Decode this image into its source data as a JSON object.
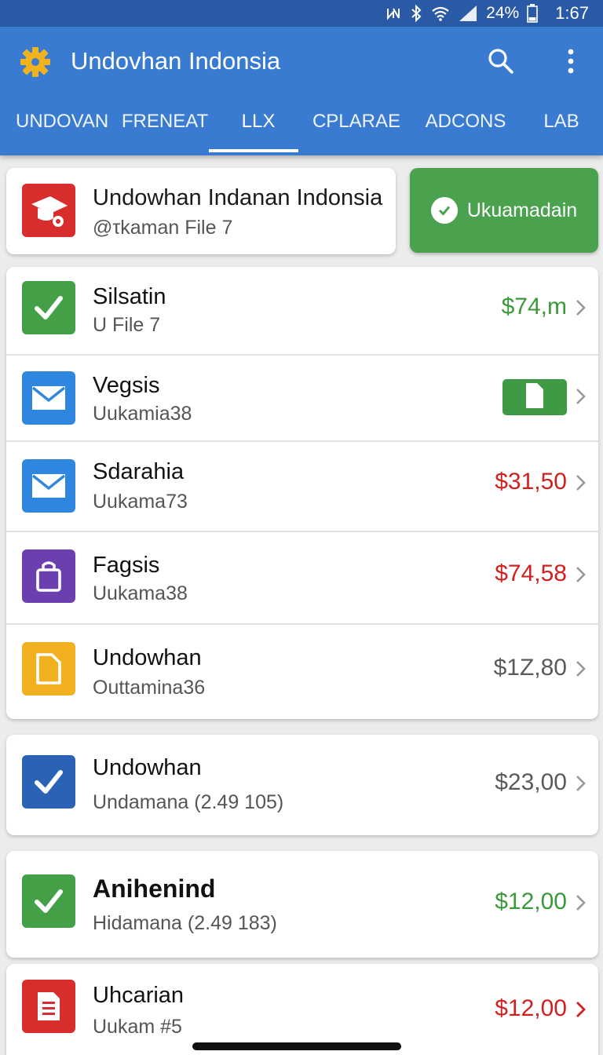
{
  "status_bar": {
    "battery": "24%",
    "time": "1:67",
    "icons": [
      "nfc-icon",
      "bluetooth-icon",
      "wifi-icon",
      "signal-icon",
      "battery-icon"
    ]
  },
  "app_bar": {
    "title": "Undovhan Indonsia",
    "logo_icon": "gear-icon",
    "color": "#3a7bd2"
  },
  "tabs": [
    {
      "label": "UNDOVAN"
    },
    {
      "label": "FRENEAT"
    },
    {
      "label": "LLX",
      "active": true
    },
    {
      "label": "CPLARAE"
    },
    {
      "label": "ADCONS"
    },
    {
      "label": "LAB"
    }
  ],
  "header_card": {
    "title": "Undowhan Indanan Indonsia",
    "subtitle": "@τkaman File 7",
    "icon": "graduation-cap-gear-icon"
  },
  "action_button": {
    "label": "Ukuamadain",
    "icon": "check-circle-icon",
    "color": "#4aa24f"
  },
  "list_group_1": [
    {
      "title": "Silsatin",
      "subtitle": "U File 7",
      "amount": "$74,m",
      "amount_color": "green",
      "icon": "checkmark-icon",
      "icon_color": "#43a047"
    },
    {
      "title": "Vegsis",
      "subtitle": "Uukamia38",
      "amount": "",
      "badge": "file-icon",
      "icon": "mail-icon",
      "icon_color": "#2e86de"
    },
    {
      "title": "Sdarahia",
      "subtitle": "Uukama73",
      "amount": "$31,50",
      "amount_color": "red",
      "icon": "mail-icon",
      "icon_color": "#2e86de"
    },
    {
      "title": "Fagsis",
      "subtitle": "Uukama38",
      "amount": "$74,58",
      "amount_color": "red",
      "icon": "shopping-bag-icon",
      "icon_color": "#6c3fae"
    },
    {
      "title": "Undowhan",
      "subtitle": "Outtamina36",
      "amount": "$1Z,80",
      "amount_color": "gray",
      "icon": "document-icon",
      "icon_color": "#f0b020"
    }
  ],
  "list_group_2": [
    {
      "title": "Undowhan",
      "subtitle": "Undamana (2.49 105)",
      "amount": "$23,00",
      "amount_color": "gray",
      "icon": "checkbox-icon",
      "icon_color": "#2a62b5"
    }
  ],
  "list_group_3": [
    {
      "title": "Anihenind",
      "subtitle": "Hidamana (2.49 183)",
      "amount": "$12,00",
      "amount_color": "green",
      "icon": "checkmark-icon",
      "icon_color": "#43a047"
    },
    {
      "title": "Uhcarian",
      "subtitle": "Uukam #5",
      "amount": "$12,00",
      "amount_color": "red",
      "icon": "receipt-icon",
      "icon_color": "#d92c2c"
    }
  ]
}
